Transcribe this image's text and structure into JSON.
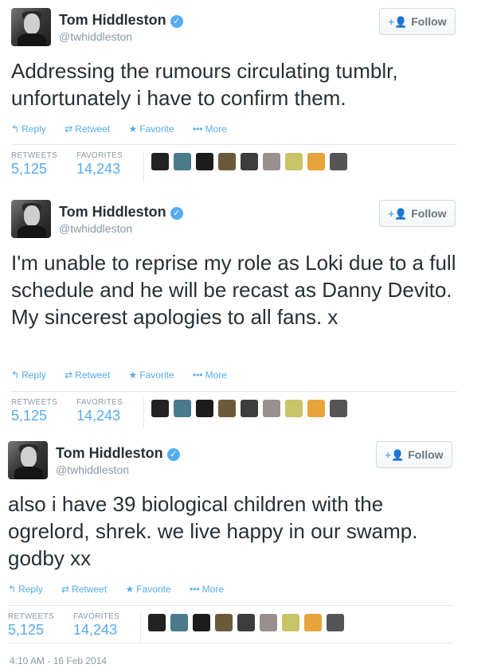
{
  "tweets": [
    {
      "name": "Tom Hiddleston",
      "handle": "@twhiddleston",
      "follow_label": "Follow",
      "text": "Addressing the rumours circulating tumblr, unfortunately i have to confirm them.",
      "actions": {
        "reply": "Reply",
        "retweet": "Retweet",
        "favorite": "Favorite",
        "more": "More"
      },
      "stats": {
        "retweets_label": "RETWEETS",
        "retweets": "5,125",
        "favorites_label": "FAVORITES",
        "favorites": "14,243"
      }
    },
    {
      "name": "Tom Hiddleston",
      "handle": "@twhiddleston",
      "follow_label": "Follow",
      "text": "I'm unable to reprise my role as Loki due to a full schedule and he will be recast as Danny Devito. My sincerest apologies to all fans. x",
      "actions": {
        "reply": "Reply",
        "retweet": "Retweet",
        "favorite": "Favorite",
        "more": "More"
      },
      "stats": {
        "retweets_label": "RETWEETS",
        "retweets": "5,125",
        "favorites_label": "FAVORITES",
        "favorites": "14,243"
      }
    },
    {
      "name": "Tom Hiddleston",
      "handle": "@twhiddleston",
      "follow_label": "Follow",
      "text": "also i have 39 biological children with the ogrelord, shrek. we live happy in our swamp. godby xx",
      "actions": {
        "reply": "Reply",
        "retweet": "Retweet",
        "favorite": "Favorite",
        "more": "More"
      },
      "stats": {
        "retweets_label": "RETWEETS",
        "retweets": "5,125",
        "favorites_label": "FAVORITES",
        "favorites": "14,243"
      },
      "timestamp": "4:10 AM - 16 Feb 2014"
    }
  ],
  "icons": {
    "verified": "verified-badge-icon",
    "follow": "add-user-icon",
    "reply": "reply-icon",
    "retweet": "retweet-icon",
    "favorite": "star-icon",
    "more": "more-dots-icon"
  },
  "colors": {
    "accent": "#55acee",
    "text": "#292f33",
    "muted": "#8899a6",
    "border": "#e1e8ed"
  }
}
